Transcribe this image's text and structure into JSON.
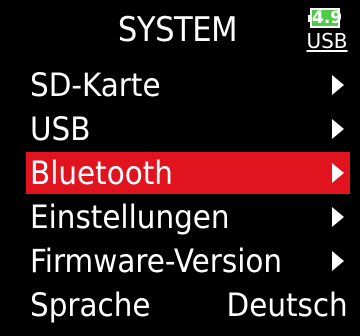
{
  "header": {
    "title": "SYSTEM",
    "battery": {
      "value": "4.9",
      "color": "#4ec94a",
      "source": "USB"
    }
  },
  "menu": {
    "selected_index": 2,
    "highlight_color": "#e0131f",
    "items": [
      {
        "label": "SD-Karte",
        "icon": "arrow-right-icon"
      },
      {
        "label": "USB",
        "icon": "arrow-right-icon"
      },
      {
        "label": "Bluetooth",
        "icon": "arrow-right-icon"
      },
      {
        "label": "Einstellungen",
        "icon": "arrow-right-icon"
      },
      {
        "label": "Firmware-Version",
        "icon": "arrow-right-icon"
      },
      {
        "label": "Sprache",
        "value": "Deutsch"
      }
    ]
  }
}
